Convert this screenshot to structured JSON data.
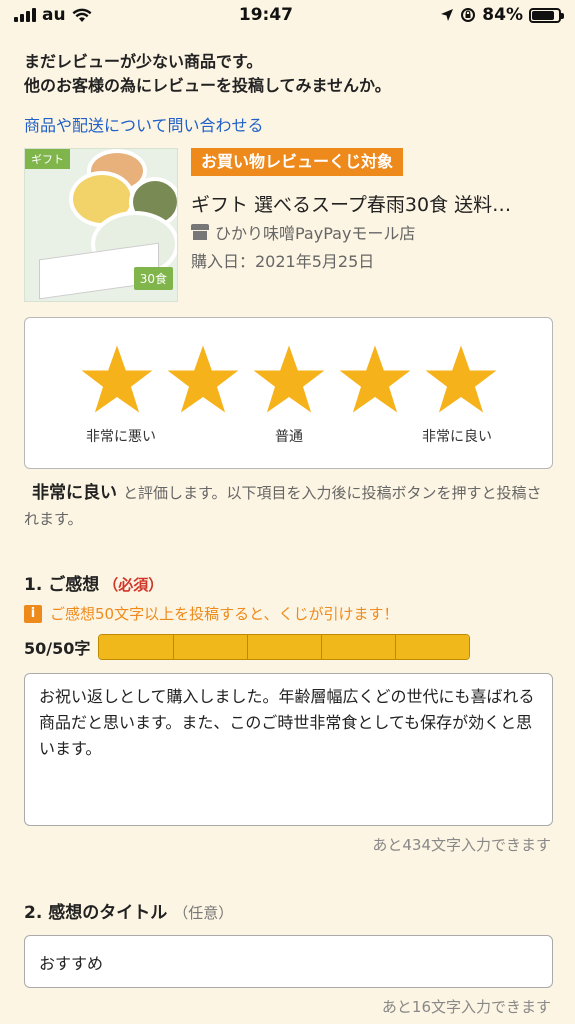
{
  "status_bar": {
    "carrier": "au",
    "time": "19:47",
    "battery": "84%",
    "battery_level": 0.84
  },
  "intro": {
    "line1": "まだレビューが少ない商品です。",
    "line2": "他のお客様の為にレビューを投稿してみませんか。"
  },
  "inquiry_link": "商品や配送について問い合わせる",
  "product": {
    "badge": "お買い物レビューくじ対象",
    "title": "ギフト 選べるスープ春雨30食 送料…",
    "store": "ひかり味噌PayPayモール店",
    "purchase_date": "購入日：2021年5月25日",
    "image_texts": {
      "gift_tag": "ギフト",
      "pack_count": "30食"
    }
  },
  "rating": {
    "value": 5,
    "max": 5,
    "star_color": "#f6b21a",
    "labels": {
      "low": "非常に悪い",
      "mid": "普通",
      "high": "非常に良い"
    }
  },
  "rating_text": {
    "selected": "非常に良い",
    "suffix": "と評価します。以下項目を入力後に投稿ボタンを押すと投稿されます。"
  },
  "section1": {
    "title": "1. ご感想",
    "required": "（必須）",
    "notice": "ご感想50文字以上を投稿すると、くじが引けます！",
    "counter": "50/50字",
    "progress": 1.0,
    "text": "お祝い返しとして購入しました。年齢層幅広くどの世代にも喜ばれる商品だと思います。また、このご時世非常食としても保存が効くと思います。",
    "remaining": "あと434文字入力できます"
  },
  "section2": {
    "title": "2. 感想のタイトル",
    "optional": "（任意）",
    "value": "おすすめ",
    "remaining": "あと16文字入力できます"
  },
  "colors": {
    "background": "#fdf5e3",
    "accent_orange": "#ee8a1c",
    "link_blue": "#2060c8",
    "required_red": "#d0372a",
    "progress_yellow": "#f0b81a"
  }
}
